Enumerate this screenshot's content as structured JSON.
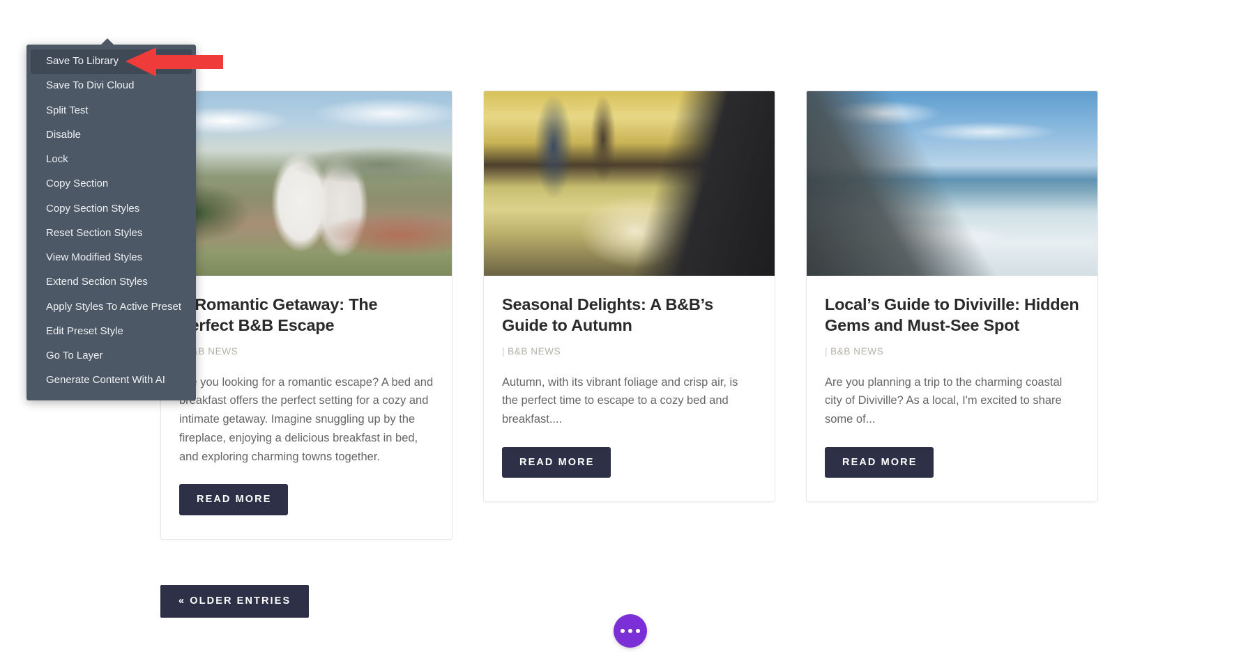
{
  "context_menu": {
    "name": "divi-section-context-menu",
    "active_item": "Save To Library",
    "items": [
      {
        "label": "Save To Library"
      },
      {
        "label": "Save To Divi Cloud"
      },
      {
        "label": "Split Test"
      },
      {
        "label": "Disable"
      },
      {
        "label": "Lock"
      },
      {
        "label": "Copy Section"
      },
      {
        "label": "Copy Section Styles"
      },
      {
        "label": "Reset Section Styles"
      },
      {
        "label": "View Modified Styles"
      },
      {
        "label": "Extend Section Styles"
      },
      {
        "label": "Apply Styles To Active Preset"
      },
      {
        "label": "Edit Preset Style"
      },
      {
        "label": "Go To Layer"
      },
      {
        "label": "Generate Content With AI"
      }
    ]
  },
  "annotation": {
    "arrow_color": "#f03b3b",
    "points_to": "Save To Library"
  },
  "blog": {
    "cards": [
      {
        "title": "A Romantic Getaway: The Perfect B&B Escape",
        "meta": "B&B NEWS",
        "meta_separator": "|",
        "excerpt": "Are you looking for a romantic escape? A bed and breakfast offers the perfect setting for a cozy and intimate getaway. Imagine snuggling up by the fireplace, enjoying a delicious breakfast in bed, and exploring charming towns together.",
        "button_label": "READ MORE",
        "image_alt": "couple-embracing-mountain-overlook-photo"
      },
      {
        "title": "Seasonal Delights: A B&B’s Guide to Autumn",
        "meta": "B&B NEWS",
        "meta_separator": "|",
        "excerpt": "Autumn, with its vibrant foliage and crisp air, is the perfect time to escape to a cozy bed and breakfast....",
        "button_label": "READ MORE",
        "image_alt": "autumn-park-painter-photo"
      },
      {
        "title": "Local’s Guide to Diviville: Hidden Gems and Must-See Spot",
        "meta": "B&B NEWS",
        "meta_separator": "|",
        "excerpt": "Are you planning a trip to the charming coastal city of Diviville? As a local, I'm excited to share some of...",
        "button_label": "READ MORE",
        "image_alt": "ocean-pier-blue-sky-photo"
      }
    ],
    "pagination": {
      "older_entries_label": "« OLDER ENTRIES"
    }
  },
  "floating_button": {
    "name": "divi-builder-fab",
    "color": "#7b2fd6",
    "icon": "three-dots-icon"
  },
  "colors": {
    "menu_background": "#4c5866",
    "menu_active": "#3f4956",
    "button_dark": "#2d3047",
    "accent_purple": "#7b2fd6",
    "annotation_red": "#f03b3b",
    "meta_text": "#b5b1aa",
    "body_text": "#666666"
  }
}
